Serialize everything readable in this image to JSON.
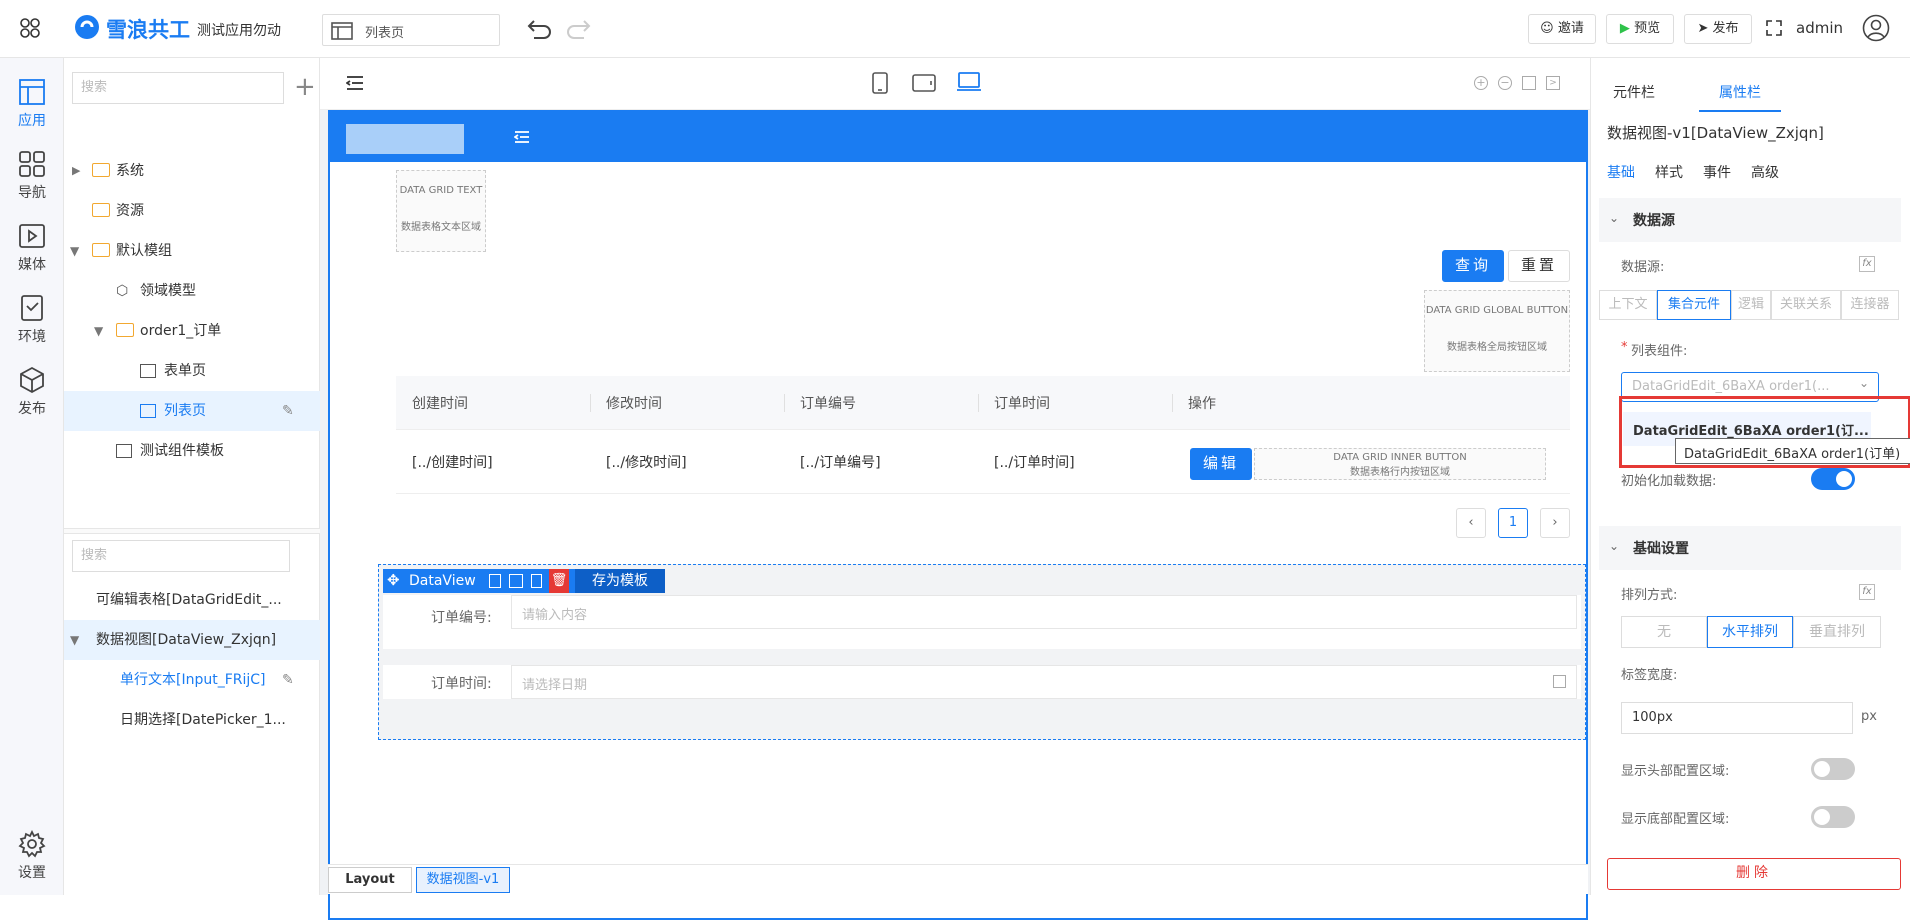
{
  "header": {
    "brand": "雪浪共工",
    "app_name": "测试应用勿动",
    "page_selector": "列表页",
    "invite": "邀请",
    "preview": "预览",
    "publish": "发布",
    "user": "admin"
  },
  "leftnav": [
    {
      "label": "应用",
      "icon": "app-layout-icon"
    },
    {
      "label": "导航",
      "icon": "grid-icon"
    },
    {
      "label": "媒体",
      "icon": "media-icon"
    },
    {
      "label": "环境",
      "icon": "environment-icon"
    },
    {
      "label": "发布",
      "icon": "cube-icon"
    }
  ],
  "leftnav_settings": "设置",
  "tree": {
    "search_placeholder": "搜索",
    "items": [
      "系统",
      "资源",
      "默认模组",
      "领域模型",
      "order1_订单",
      "表单页",
      "列表页",
      "测试组件模板"
    ]
  },
  "outline": {
    "search_placeholder": "搜索",
    "items": [
      "可编辑表格[DataGridEdit_...",
      "数据视图[DataView_Zxjqn]",
      "单行文本[Input_FRijC]",
      "日期选择[DatePicker_1..."
    ]
  },
  "canvas": {
    "grid_text_title": "DATA GRID TEXT",
    "grid_text_sub": "数据表格文本区域",
    "query": "查询",
    "reset": "重置",
    "global_btn_title": "DATA GRID GLOBAL BUTTON",
    "global_btn_sub": "数据表格全局按钮区域",
    "columns": [
      "创建时间",
      "修改时间",
      "订单编号",
      "订单时间",
      "操作"
    ],
    "row": [
      "[../创建时间]",
      "[../修改时间]",
      "[../订单编号]",
      "[../订单时间]"
    ],
    "edit": "编辑",
    "inner_btn_title": "DATA GRID INNER BUTTON",
    "inner_btn_sub": "数据表格行内按钮区域",
    "page": "1",
    "dataview_label": "DataView",
    "save_template": "存为模板",
    "field1_label": "订单编号:",
    "field1_placeholder": "请输入内容",
    "field2_label": "订单时间:",
    "field2_placeholder": "请选择日期"
  },
  "breadcrumbs": [
    "Layout",
    "数据视图-v1"
  ],
  "props": {
    "tabs": [
      "元件栏",
      "属性栏"
    ],
    "title": "数据视图-v1[DataView_Zxjqn]",
    "subtabs": [
      "基础",
      "样式",
      "事件",
      "高级"
    ],
    "section1": "数据源",
    "datasource_label": "数据源:",
    "source_tabs": [
      "上下文",
      "集合元件",
      "逻辑",
      "关联关系",
      "连接器"
    ],
    "list_label": "列表组件:",
    "select_value": "DataGridEdit_6BaXA order1(...",
    "dropdown_option": "DataGridEdit_6BaXA order1(订...",
    "tooltip": "DataGridEdit_6BaXA order1(订单)",
    "init_load": "初始化加载数据:",
    "section2": "基础设置",
    "arrange_label": "排列方式:",
    "arrange_options": [
      "无",
      "水平排列",
      "垂直排列"
    ],
    "label_width": "标签宽度:",
    "label_width_value": "100px",
    "unit": "px",
    "show_header": "显示头部配置区域:",
    "show_footer": "显示底部配置区域:",
    "delete": "删除"
  },
  "colors": {
    "accent": "#1a7cf2",
    "danger": "#e53935"
  }
}
